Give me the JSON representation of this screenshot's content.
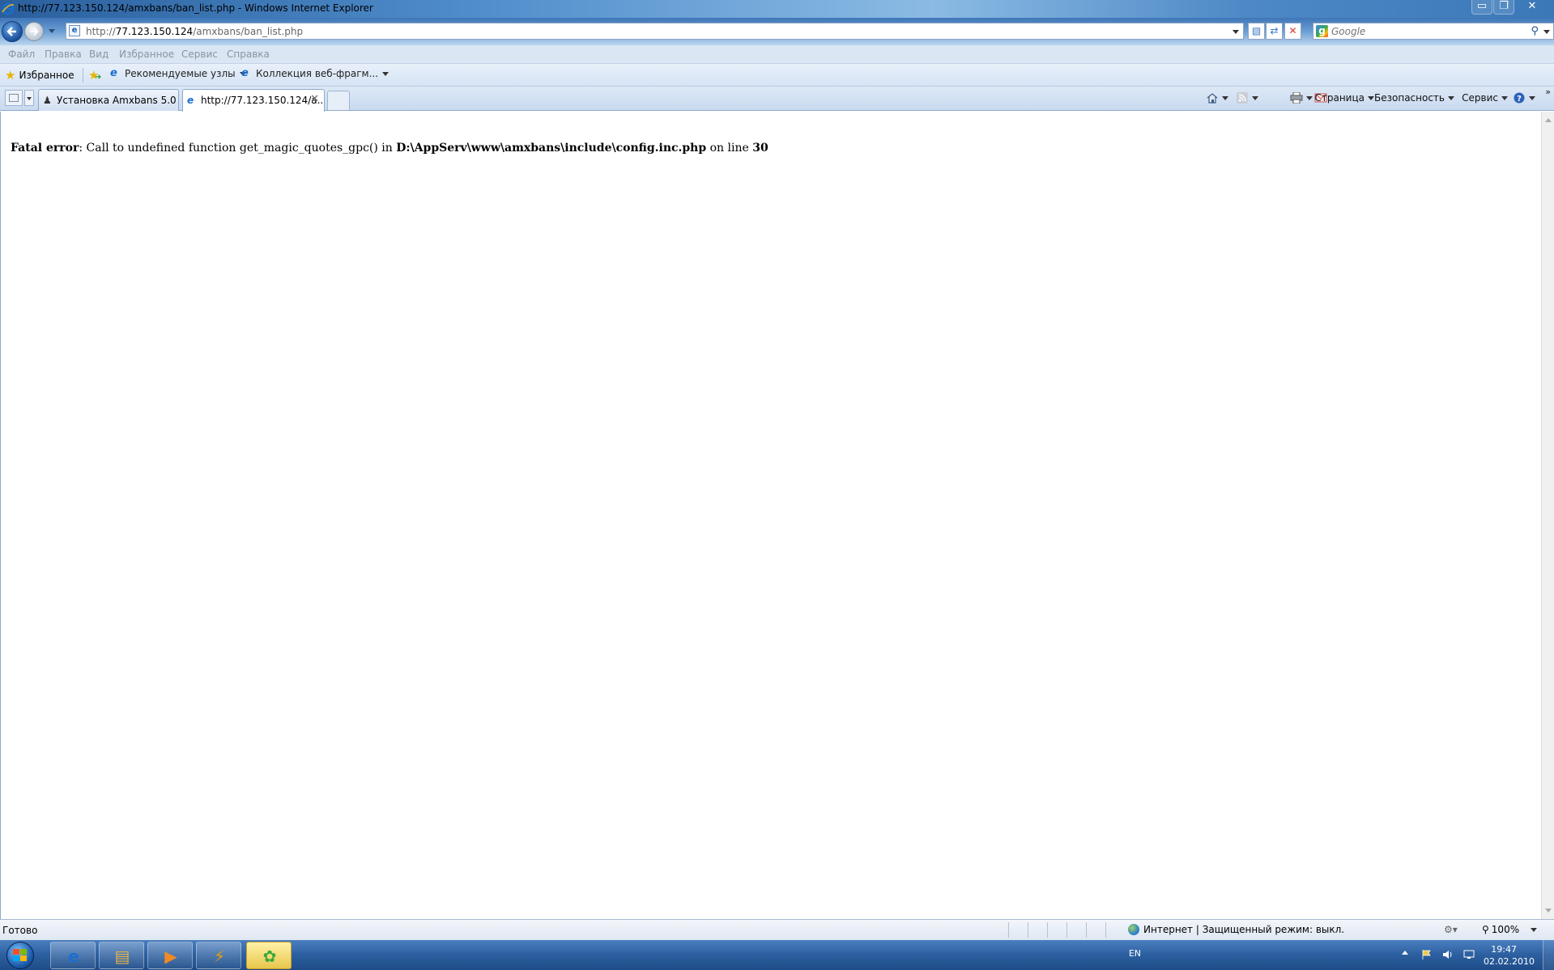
{
  "window": {
    "title": "http://77.123.150.124/amxbans/ban_list.php - Windows Internet Explorer",
    "buttons": {
      "minimize": "▭",
      "maximize": "❐",
      "close": "✕"
    }
  },
  "address_bar": {
    "url_prefix": "http://",
    "url_host": "77.123.150.124",
    "url_path": "/amxbans/ban_list.php",
    "search_placeholder": "Google"
  },
  "menu": {
    "items": [
      "Файл",
      "Правка",
      "Вид",
      "Избранное",
      "Сервис",
      "Справка"
    ]
  },
  "favorites_bar": {
    "favorites_label": "Избранное",
    "links": [
      {
        "label": "Рекомендуемые узлы",
        "icon": "ie-icon"
      },
      {
        "label": "Коллекция веб-фрагм...",
        "icon": "ie-icon"
      }
    ]
  },
  "tabs": [
    {
      "label": "Установка Amxbans 5.0 - ...",
      "icon": "avatar-icon",
      "active": false
    },
    {
      "label": "http://77.123.150.124/a...",
      "icon": "ie-icon",
      "active": true
    }
  ],
  "command_bar": {
    "page_label": "Страница",
    "safety_label": "Безопасность",
    "tools_label": "Сервис",
    "icons": [
      "home-icon",
      "rss-feed-icon",
      "mail-icon",
      "print-icon",
      "help-icon"
    ]
  },
  "content": {
    "error_label": "Fatal error",
    "error_text": ": Call to undefined function get_magic_quotes_gpc() in ",
    "error_file": "D:\\AppServ\\www\\amxbans\\include\\config.inc.php",
    "error_online": " on line ",
    "error_line": "30"
  },
  "status_bar": {
    "status": "Готово",
    "zone": "Интернет | Защищенный режим: выкл.",
    "zoom": "100%"
  },
  "taskbar": {
    "apps": [
      {
        "name": "internet-explorer",
        "glyph": "e",
        "color": "#1a6ed1",
        "active": false
      },
      {
        "name": "windows-explorer",
        "glyph": "▤",
        "color": "#e2b34a",
        "active": false
      },
      {
        "name": "media-player",
        "glyph": "▶",
        "color": "#f08a24",
        "active": false
      },
      {
        "name": "winamp",
        "glyph": "⚡",
        "color": "#e8a000",
        "active": false
      },
      {
        "name": "icq",
        "glyph": "✿",
        "color": "#3aa83a",
        "active": true
      }
    ],
    "lang": "EN",
    "time": "19:47",
    "date": "02.02.2010"
  }
}
